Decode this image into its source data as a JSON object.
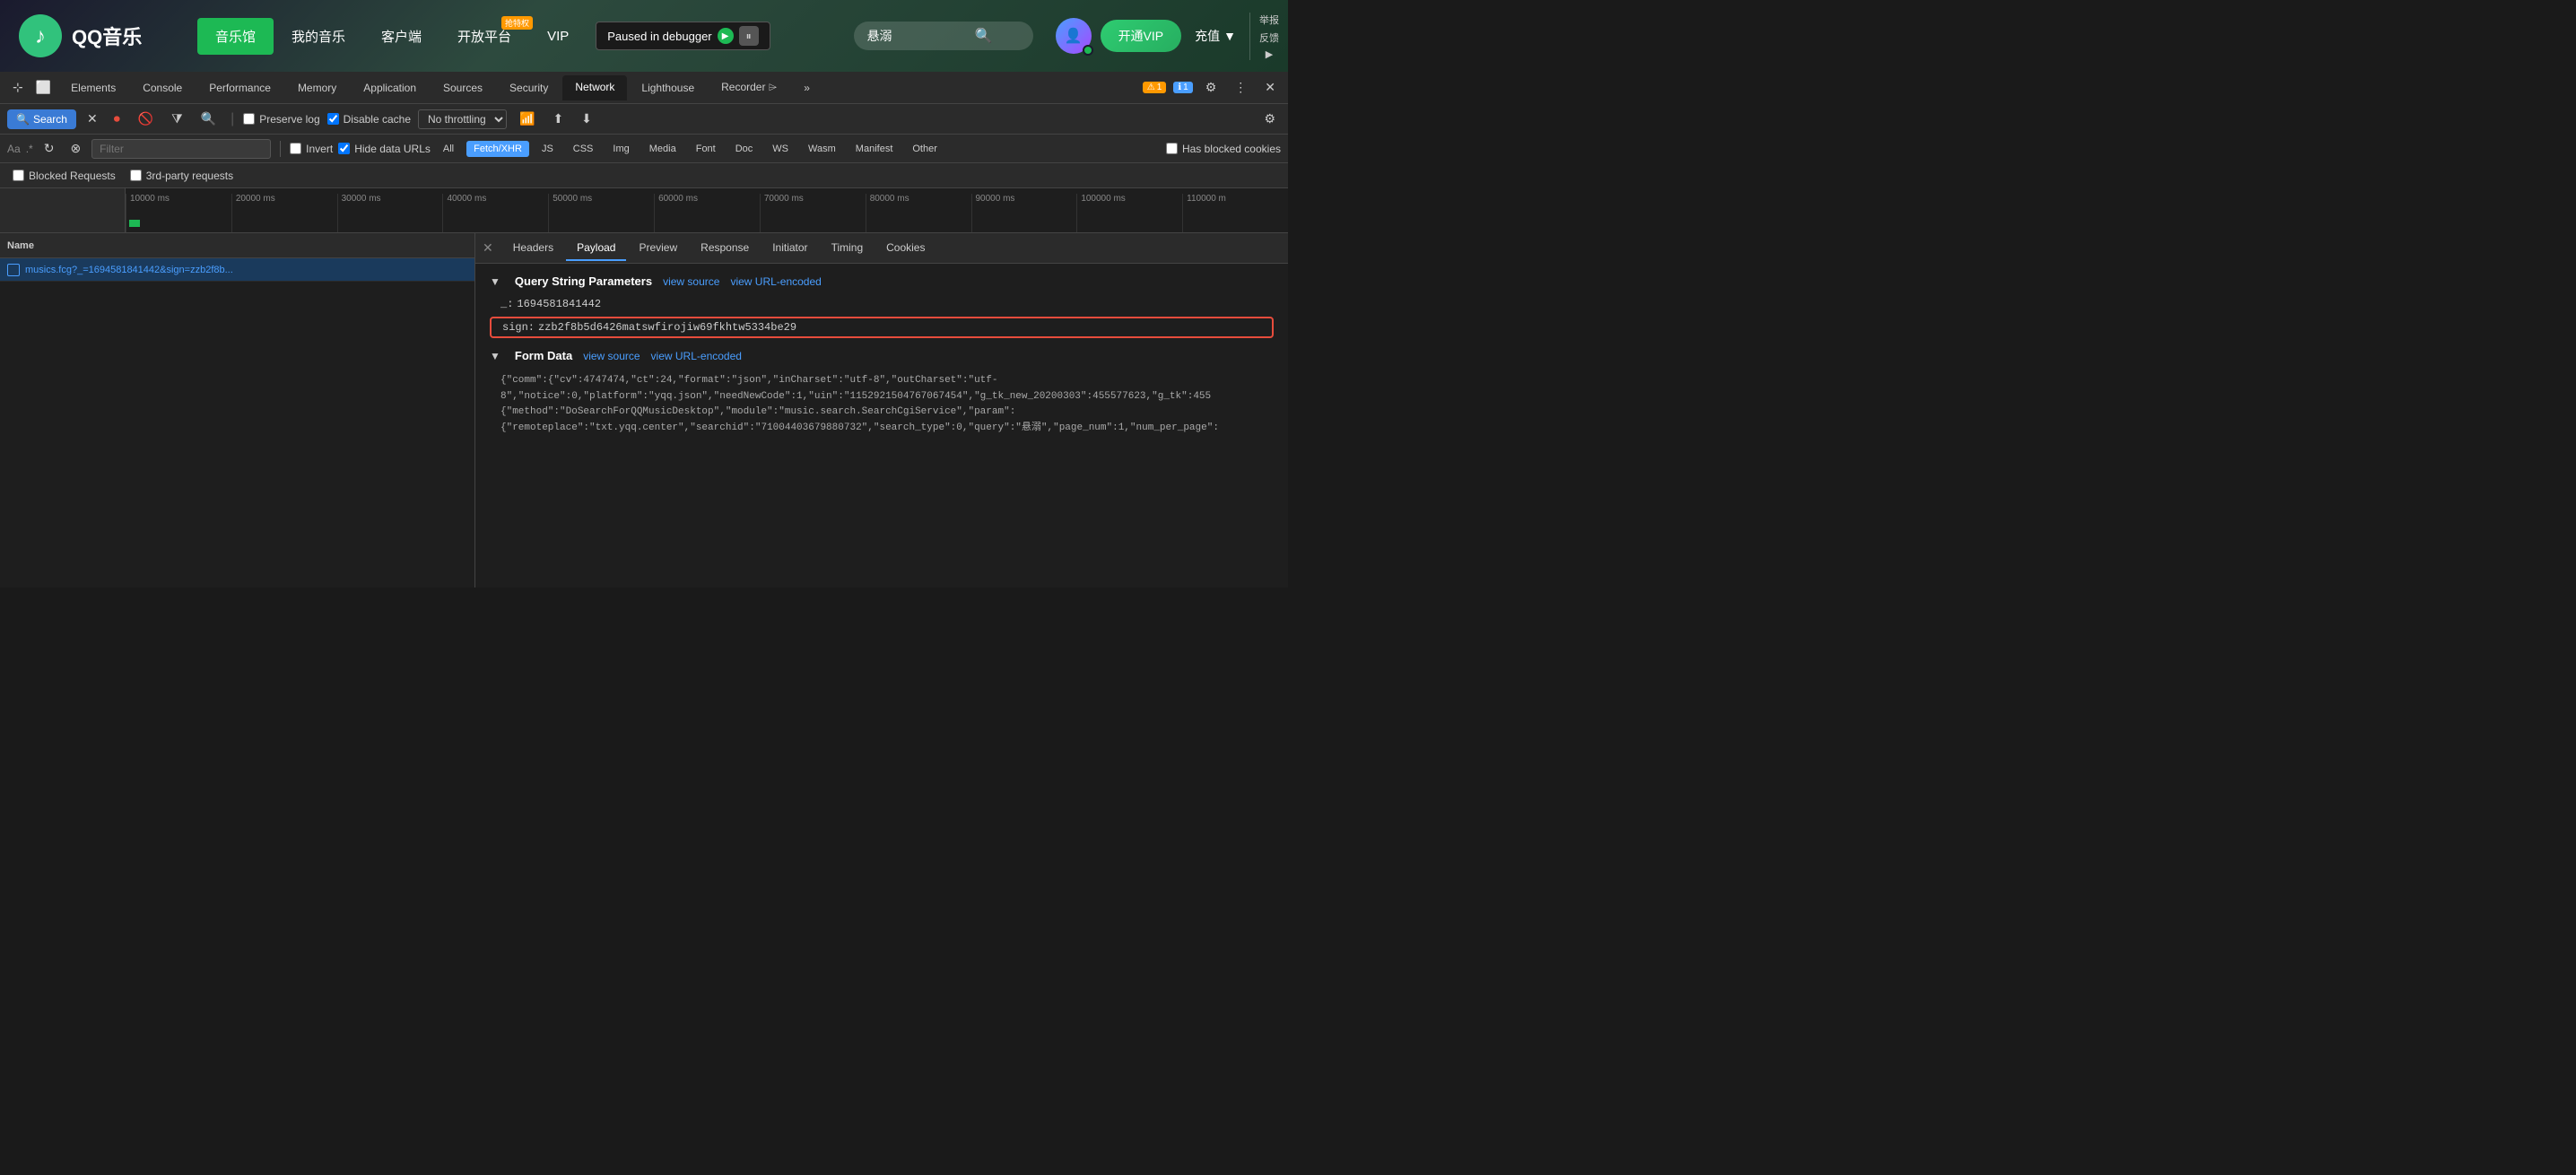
{
  "qqmusic": {
    "logo_text": "QQ音乐",
    "nav": {
      "music_hall": "音乐馆",
      "my_music": "我的音乐",
      "client": "客户端",
      "open_platform_label": "开放平台",
      "open_platform_badge": "抢特权",
      "vip": "VIP",
      "search_placeholder": "悬溺",
      "open_vip_btn": "开通VIP",
      "charge_btn": "充值",
      "top_right_1": "举报",
      "top_right_2": "反馈"
    },
    "debugger": {
      "label": "Paused in debugger"
    }
  },
  "devtools": {
    "tabs": [
      {
        "label": "Elements"
      },
      {
        "label": "Console"
      },
      {
        "label": "Performance"
      },
      {
        "label": "Memory"
      },
      {
        "label": "Application"
      },
      {
        "label": "Sources"
      },
      {
        "label": "Security"
      },
      {
        "label": "Network",
        "active": true
      },
      {
        "label": "Lighthouse"
      },
      {
        "label": "Recorder ⌲"
      },
      {
        "label": "»"
      }
    ],
    "warning_count": "1",
    "info_count": "1",
    "toolbar": {
      "search_btn": "Search",
      "preserve_log_label": "Preserve log",
      "disable_cache_label": "Disable cache",
      "no_throttling_label": "No throttling",
      "import_btn": "⬆",
      "export_btn": "⬇",
      "settings_btn": "⚙"
    },
    "filter": {
      "placeholder": "Filter",
      "invert_label": "Invert",
      "hide_data_urls_label": "Hide data URLs",
      "all_label": "All",
      "fetch_xhr_label": "Fetch/XHR",
      "js_label": "JS",
      "css_label": "CSS",
      "img_label": "Img",
      "media_label": "Media",
      "font_label": "Font",
      "doc_label": "Doc",
      "ws_label": "WS",
      "wasm_label": "Wasm",
      "manifest_label": "Manifest",
      "other_label": "Other",
      "has_blocked_label": "Has blocked cookies"
    },
    "request_filters": {
      "blocked_requests": "Blocked Requests",
      "third_party": "3rd-party requests"
    },
    "timeline": {
      "labels": [
        "10000 ms",
        "20000 ms",
        "30000 ms",
        "40000 ms",
        "50000 ms",
        "60000 ms",
        "70000 ms",
        "80000 ms",
        "90000 ms",
        "100000 ms",
        "110000 m"
      ]
    },
    "request_list": {
      "header": "Name",
      "items": [
        {
          "name": "musics.fcg?_=1694581841442&sign=zzb2f8b...",
          "selected": true
        }
      ]
    },
    "detail": {
      "tabs": [
        "Headers",
        "Payload",
        "Preview",
        "Response",
        "Initiator",
        "Timing",
        "Cookies"
      ],
      "active_tab": "Payload",
      "query_string": {
        "section_title": "Query String Parameters",
        "view_source_link": "view source",
        "view_url_encoded_link": "view URL-encoded",
        "params": [
          {
            "key": "_:",
            "value": "1694581841442"
          },
          {
            "key": "sign:",
            "value": "zzb2f8b5d6426matswfirojiw69fkhtw5334be29",
            "highlighted": true
          }
        ]
      },
      "form_data": {
        "section_title": "Form Data",
        "view_source_link": "view source",
        "view_url_encoded_link": "view URL-encoded",
        "content_line1": "{\"comm\":{\"cv\":4747474,\"ct\":24,\"format\":\"json\",\"inCharset\":\"utf-8\",\"outCharset\":\"utf-",
        "content_line2": "8\",\"notice\":0,\"platform\":\"yqq.json\",\"needNewCode\":1,\"uin\":\"1152921504767067454\",\"g_tk_new_20200303\":455577623,\"g_tk\":455",
        "content_line3": "{\"method\":\"DoSearchForQQMusicDesktop\",\"module\":\"music.search.SearchCgiService\",\"param\":",
        "content_line4": "{\"remoteplace\":\"txt.yqq.center\",\"searchid\":\"71004403679880732\",\"search_type\":0,\"query\":\"悬溺\",\"page_num\":1,\"num_per_page\":"
      }
    }
  }
}
